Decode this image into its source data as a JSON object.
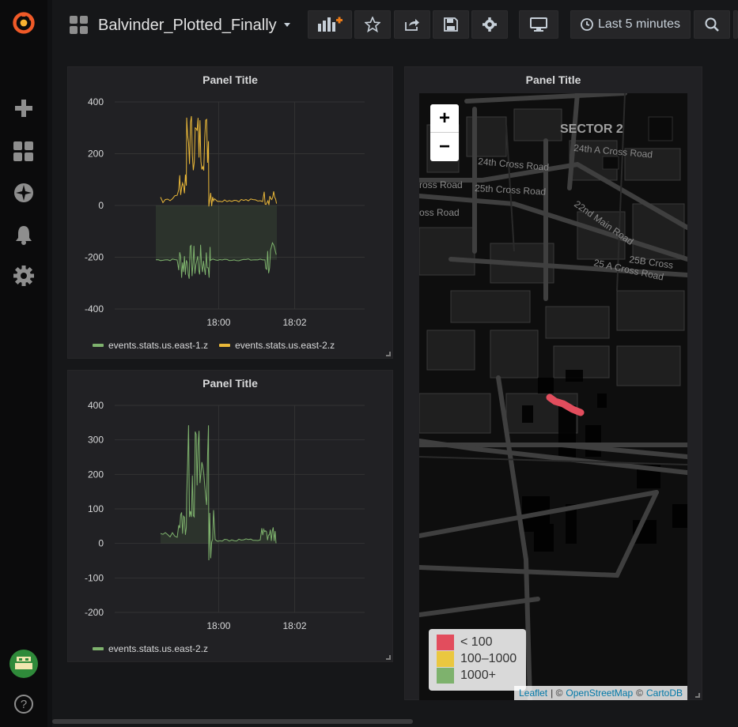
{
  "navbar": {
    "dashboard_title": "Balvinder_Plotted_Finally",
    "time_range": "Last 5 minutes"
  },
  "panels": [
    {
      "title": "Panel Title",
      "legend": [
        {
          "name": "events.stats.us.east-1.z",
          "color": "#7eb26d"
        },
        {
          "name": "events.stats.us.east-2.z",
          "color": "#eab839"
        }
      ]
    },
    {
      "title": "Panel Title",
      "legend": [
        {
          "name": "events.stats.us.east-2.z",
          "color": "#7eb26d"
        }
      ]
    },
    {
      "title": "Panel Title"
    }
  ],
  "chart_data": [
    {
      "type": "line",
      "ylim": [
        -400,
        400
      ],
      "y_ticks": [
        "400",
        "200",
        "0",
        "-200",
        "-400"
      ],
      "x_ticks": [
        "18:00",
        "18:02"
      ],
      "grid": true,
      "legend_position": "bottom-left",
      "series": [
        {
          "name": "events.stats.us.east-1.z",
          "color": "#7eb26d"
        },
        {
          "name": "events.stats.us.east-2.z",
          "color": "#eab839"
        }
      ]
    },
    {
      "type": "line",
      "ylim": [
        -200,
        400
      ],
      "y_ticks": [
        "400",
        "300",
        "200",
        "100",
        "0",
        "-100",
        "-200"
      ],
      "x_ticks": [
        "18:00",
        "18:02"
      ],
      "grid": true,
      "legend_position": "bottom-left",
      "series": [
        {
          "name": "events.stats.us.east-2.z",
          "color": "#7eb26d"
        }
      ]
    }
  ],
  "map": {
    "zoom_in": "+",
    "zoom_out": "−",
    "labels": [
      "SECTOR 2",
      "24th A Cross Road",
      "24th Cross Road",
      "ross Road",
      "25th Cross Road",
      "oss Road",
      "22nd Main Road",
      "25B Cross",
      "25 A Cross Road"
    ],
    "legend": [
      {
        "label": "< 100",
        "color": "#e24d5d"
      },
      {
        "label": "100–1000",
        "color": "#eac740"
      },
      {
        "label": "1000+",
        "color": "#7eb26d"
      }
    ],
    "attribution": {
      "leaflet": "Leaflet",
      "sep1": "| ©",
      "osm": "OpenStreetMap",
      "sep2": "©",
      "carto": "CartoDB"
    }
  }
}
